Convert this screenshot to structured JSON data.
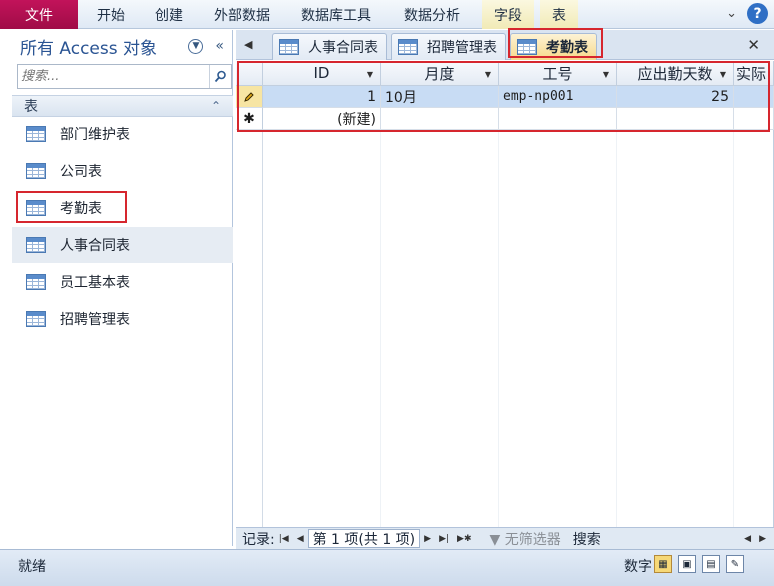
{
  "ribbon": {
    "file_tab": "文件",
    "tabs": [
      "开始",
      "创建",
      "外部数据",
      "数据库工具",
      "数据分析"
    ],
    "context_tabs": [
      "字段",
      "表"
    ]
  },
  "nav": {
    "title": "所有 Access 对象",
    "search_placeholder": "搜索...",
    "group_label": "表",
    "items": [
      "部门维护表",
      "公司表",
      "考勤表",
      "人事合同表",
      "员工基本表",
      "招聘管理表"
    ]
  },
  "doc_tabs": [
    "人事合同表",
    "招聘管理表",
    "考勤表"
  ],
  "active_tab": "考勤表",
  "table": {
    "columns": [
      "ID",
      "月度",
      "工号",
      "应出勤天数",
      "实际"
    ],
    "rows": [
      {
        "id": "1",
        "month": "10月",
        "empno": "emp-np001",
        "days": "25"
      }
    ],
    "new_row_label": "(新建)"
  },
  "record_nav": {
    "label": "记录:",
    "current": "第 1 项(共 1 项)",
    "filter": "无筛选器",
    "search": "搜索"
  },
  "status": {
    "ready": "就绪",
    "numlock": "数字"
  },
  "colors": {
    "file_tab": "#a00c47",
    "highlight_box": "#d6262e",
    "selected_row": "#c8dcf4"
  }
}
